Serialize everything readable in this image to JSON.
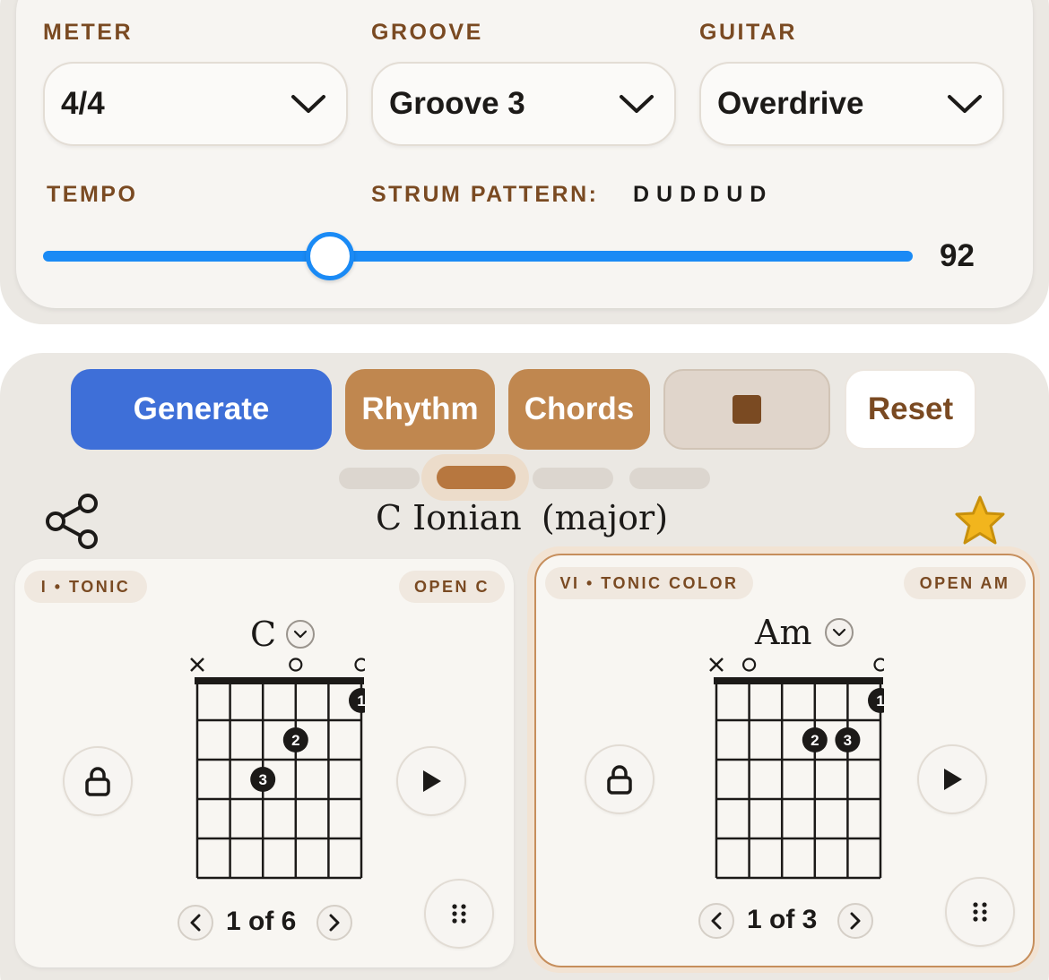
{
  "settings": {
    "meter": {
      "label": "METER",
      "value": "4/4"
    },
    "groove": {
      "label": "GROOVE",
      "value": "Groove 3"
    },
    "guitar": {
      "label": "GUITAR",
      "value": "Overdrive"
    },
    "tempo": {
      "label": "TEMPO",
      "value": "92",
      "slider_fraction": 0.33
    },
    "strum": {
      "label": "STRUM PATTERN:",
      "value": "DUDDUD"
    }
  },
  "actions": {
    "generate": "Generate",
    "rhythm": "Rhythm",
    "chords": "Chords",
    "reset": "Reset"
  },
  "pager": {
    "total": 4,
    "active_index": 1
  },
  "mode_title": {
    "key": "C Ionian",
    "quality": "(major)"
  },
  "chords": [
    {
      "degree": "I • TONIC",
      "voicing_name": "OPEN C",
      "name": "C",
      "voicing_counter": "1 of 6",
      "string_markers": [
        "x",
        "",
        "",
        "o",
        "",
        "o"
      ],
      "fingers": [
        {
          "string": 5,
          "fret": 1,
          "finger": "1"
        },
        {
          "string": 3,
          "fret": 2,
          "finger": "2"
        },
        {
          "string": 2,
          "fret": 3,
          "finger": "3"
        }
      ],
      "selected": false
    },
    {
      "degree": "VI • TONIC COLOR",
      "voicing_name": "OPEN AM",
      "name": "Am",
      "voicing_counter": "1 of 3",
      "string_markers": [
        "x",
        "o",
        "",
        "",
        "",
        "o"
      ],
      "fingers": [
        {
          "string": 5,
          "fret": 1,
          "finger": "1"
        },
        {
          "string": 3,
          "fret": 2,
          "finger": "2"
        },
        {
          "string": 4,
          "fret": 2,
          "finger": "3"
        }
      ],
      "selected": true
    }
  ],
  "colors": {
    "accent_brown": "#7a4a22",
    "tab_brown": "#c0874f",
    "generate_blue": "#3e6fd8",
    "slider_blue": "#1a8af5",
    "star_gold": "#f2b51d"
  }
}
